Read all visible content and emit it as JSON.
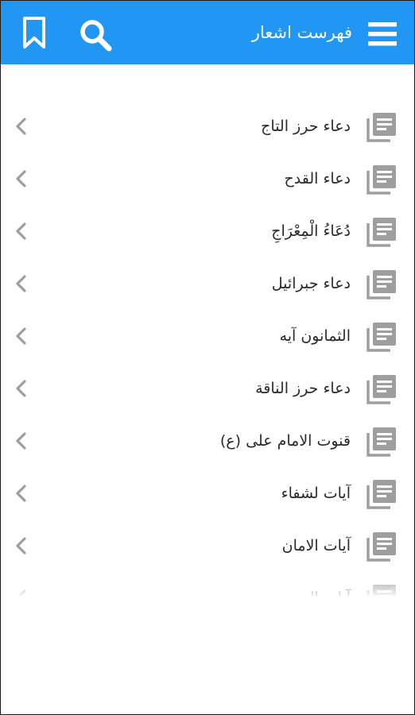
{
  "header": {
    "title": "فهرست اشعار",
    "icons": {
      "menu": "hamburger-menu-icon",
      "search": "search-icon",
      "bookmark": "bookmark-icon"
    },
    "background": "#2196f3"
  },
  "list": {
    "items": [
      {
        "label": "دعاء حرز التاج"
      },
      {
        "label": "دعاء القدح"
      },
      {
        "label": "دُعَاءُ الْمِعْرَاجِ"
      },
      {
        "label": "دعاء جبرائیل"
      },
      {
        "label": "الثمانون آیه"
      },
      {
        "label": "دعاء حرز الناقة"
      },
      {
        "label": "قنوت الامام علی (ع)"
      },
      {
        "label": "آیات لشفاء"
      },
      {
        "label": "آیات الامان"
      },
      {
        "label": "آیات الحرز"
      }
    ],
    "item_icon": "document-stack-icon",
    "chevron_icon": "chevron-left-icon",
    "icon_color": "#9e9e9e"
  }
}
